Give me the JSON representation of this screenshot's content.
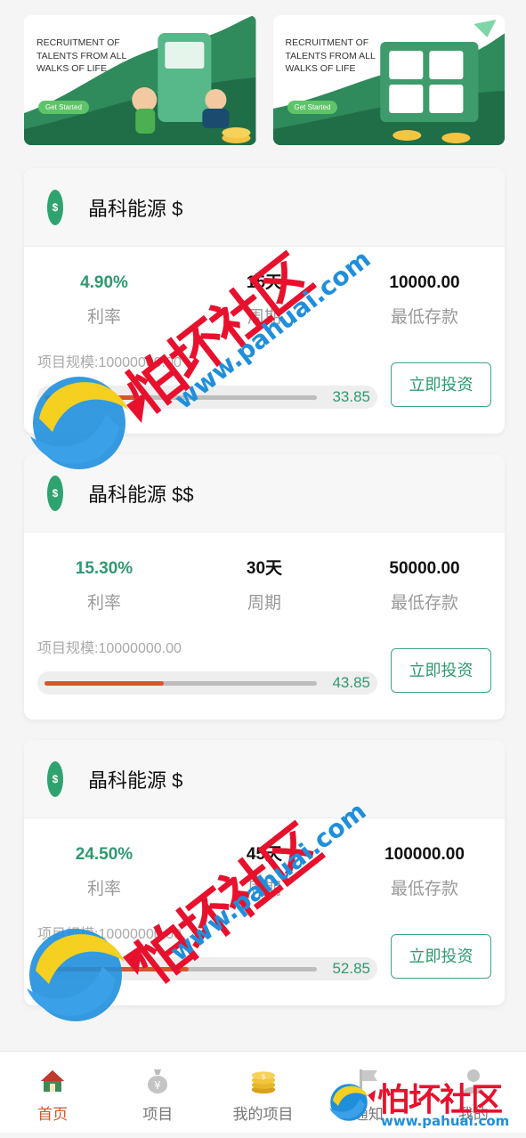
{
  "banners": [
    {
      "text": "RECRUITMENT OF TALENTS FROM ALL WALKS OF LIFE",
      "button": "Get Started"
    },
    {
      "text": "RECRUITMENT OF TALENTS FROM ALL WALKS OF LIFE",
      "button": "Get Started"
    }
  ],
  "labels": {
    "rate": "利率",
    "period": "周期",
    "min_deposit": "最低存款",
    "invest": "立即投资"
  },
  "products": [
    {
      "name": "晶科能源 $",
      "rate": "4.90%",
      "period": "15天",
      "min_deposit": "10000.00",
      "scale": "项目规模:10000000.00",
      "progress": 33.85,
      "progress_text": "33.85"
    },
    {
      "name": "晶科能源 $$",
      "rate": "15.30%",
      "period": "30天",
      "min_deposit": "50000.00",
      "scale": "项目规模:10000000.00",
      "progress": 43.85,
      "progress_text": "43.85"
    },
    {
      "name": "晶科能源 $",
      "rate": "24.50%",
      "period": "45天",
      "min_deposit": "100000.00",
      "scale": "项目规模:10000000.00",
      "progress": 52.85,
      "progress_text": "52.85"
    }
  ],
  "tabbar": {
    "items": [
      {
        "label": "首页",
        "icon": "home-icon",
        "active": true
      },
      {
        "label": "项目",
        "icon": "money-bag-icon",
        "active": false
      },
      {
        "label": "我的项目",
        "icon": "coins-icon",
        "active": false
      },
      {
        "label": "通知",
        "icon": "flag-icon",
        "active": false
      },
      {
        "label": "我的",
        "icon": "user-icon",
        "active": false
      }
    ]
  },
  "watermark": {
    "cn": "怕坏社区",
    "url": "www.pahuai.com"
  },
  "colors": {
    "accent_green": "#2e9a6f",
    "progress_red": "#d9532c",
    "active_tab": "#d9532c"
  }
}
